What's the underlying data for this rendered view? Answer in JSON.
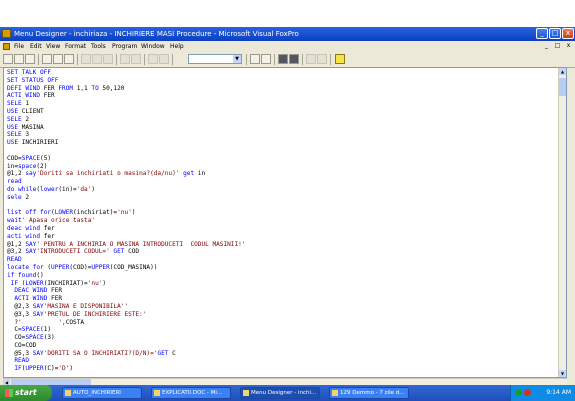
{
  "window": {
    "title": "Menu Designer - inchiriaza - INCHIRIERE MASI Procedure - Microsoft Visual FoxPro",
    "controls": {
      "minimize": "_",
      "maximize": "□",
      "close": "x"
    }
  },
  "menubar": {
    "items": [
      "File",
      "Edit",
      "View",
      "Format",
      "Tools",
      "Program",
      "Window",
      "Help"
    ],
    "mdi_controls": [
      "_",
      "□",
      "x"
    ]
  },
  "toolbar": {
    "icons": [
      "new-icon",
      "open-icon",
      "save-icon",
      "print-icon",
      "print-preview-icon",
      "spell-check-icon",
      "cut-icon",
      "copy-icon",
      "paste-icon",
      "undo-icon",
      "redo-icon",
      "run-icon",
      "modify-form-icon",
      "database-combo",
      "command-window-icon",
      "view-window-icon",
      "form-wizard-icon",
      "report-wizard-icon",
      "autoform-icon",
      "autoreport-icon",
      "help-icon"
    ],
    "combo_value": ""
  },
  "editor": {
    "lines": [
      [
        {
          "t": "kw",
          "v": "SET TALK OFF"
        }
      ],
      [
        {
          "t": "kw",
          "v": "SET STATUS OFF"
        }
      ],
      [
        {
          "t": "kw",
          "v": "DEFI WIND "
        },
        {
          "t": "txt",
          "v": "FER "
        },
        {
          "t": "kw",
          "v": "FROM "
        },
        {
          "t": "txt",
          "v": "1,1 "
        },
        {
          "t": "kw",
          "v": "TO "
        },
        {
          "t": "txt",
          "v": "50,120"
        }
      ],
      [
        {
          "t": "kw",
          "v": "ACTI WIND "
        },
        {
          "t": "txt",
          "v": "FER"
        }
      ],
      [
        {
          "t": "kw",
          "v": "SELE "
        },
        {
          "t": "txt",
          "v": "1"
        }
      ],
      [
        {
          "t": "kw",
          "v": "USE "
        },
        {
          "t": "txt",
          "v": "CLIENT"
        }
      ],
      [
        {
          "t": "kw",
          "v": "SELE "
        },
        {
          "t": "txt",
          "v": "2"
        }
      ],
      [
        {
          "t": "kw",
          "v": "USE "
        },
        {
          "t": "txt",
          "v": "MASINA"
        }
      ],
      [
        {
          "t": "kw",
          "v": "SELE "
        },
        {
          "t": "txt",
          "v": "3"
        }
      ],
      [
        {
          "t": "kw",
          "v": "USE "
        },
        {
          "t": "txt",
          "v": "INCHIRIERI"
        }
      ],
      [],
      [
        {
          "t": "txt",
          "v": "COD="
        },
        {
          "t": "kw",
          "v": "SPACE"
        },
        {
          "t": "txt",
          "v": "(5)"
        }
      ],
      [
        {
          "t": "txt",
          "v": "in="
        },
        {
          "t": "kw",
          "v": "space"
        },
        {
          "t": "txt",
          "v": "(2)"
        }
      ],
      [
        {
          "t": "txt",
          "v": "@1,2 "
        },
        {
          "t": "kw",
          "v": "say"
        },
        {
          "t": "str",
          "v": "'Doriti sa inchiriati o masina?(da/nu)' "
        },
        {
          "t": "kw",
          "v": "get "
        },
        {
          "t": "txt",
          "v": "in"
        }
      ],
      [
        {
          "t": "kw",
          "v": "read"
        }
      ],
      [
        {
          "t": "kw",
          "v": "do while"
        },
        {
          "t": "txt",
          "v": "("
        },
        {
          "t": "kw",
          "v": "lower"
        },
        {
          "t": "txt",
          "v": "(in)="
        },
        {
          "t": "str",
          "v": "'da'"
        },
        {
          "t": "txt",
          "v": ")"
        }
      ],
      [
        {
          "t": "kw",
          "v": "sele "
        },
        {
          "t": "txt",
          "v": "2"
        }
      ],
      [],
      [
        {
          "t": "kw",
          "v": "list off for"
        },
        {
          "t": "txt",
          "v": "("
        },
        {
          "t": "kw",
          "v": "LOWER"
        },
        {
          "t": "txt",
          "v": "(inchiriat)="
        },
        {
          "t": "str",
          "v": "'nu'"
        },
        {
          "t": "txt",
          "v": ")"
        }
      ],
      [
        {
          "t": "kw",
          "v": "wait"
        },
        {
          "t": "str",
          "v": "' Apasa orice tasta'"
        }
      ],
      [
        {
          "t": "kw",
          "v": "deac wind "
        },
        {
          "t": "txt",
          "v": "fer"
        }
      ],
      [
        {
          "t": "kw",
          "v": "acti wind "
        },
        {
          "t": "txt",
          "v": "fer"
        }
      ],
      [
        {
          "t": "txt",
          "v": "@1,2 "
        },
        {
          "t": "kw",
          "v": "SAY"
        },
        {
          "t": "str",
          "v": "' PENTRU A INCHIRIA O MASINA INTRODUCETI  CODUL MASINII!'"
        }
      ],
      [
        {
          "t": "txt",
          "v": "@3,2 "
        },
        {
          "t": "kw",
          "v": "SAY"
        },
        {
          "t": "str",
          "v": "'INTRODUCETI CODUL='"
        },
        {
          "t": "txt",
          "v": " "
        },
        {
          "t": "kw",
          "v": "GET "
        },
        {
          "t": "txt",
          "v": "COD"
        }
      ],
      [
        {
          "t": "kw",
          "v": "READ"
        }
      ],
      [
        {
          "t": "kw",
          "v": "locate for "
        },
        {
          "t": "txt",
          "v": "("
        },
        {
          "t": "kw",
          "v": "UPPER"
        },
        {
          "t": "txt",
          "v": "(COD)="
        },
        {
          "t": "kw",
          "v": "UPPER"
        },
        {
          "t": "txt",
          "v": "(COD_MASINA))"
        }
      ],
      [
        {
          "t": "kw",
          "v": "if found"
        },
        {
          "t": "txt",
          "v": "()"
        }
      ],
      [
        {
          "t": "txt",
          "v": " "
        },
        {
          "t": "kw",
          "v": "IF "
        },
        {
          "t": "txt",
          "v": "("
        },
        {
          "t": "kw",
          "v": "LOWER"
        },
        {
          "t": "txt",
          "v": "(INCHIRIAT)="
        },
        {
          "t": "str",
          "v": "'nu'"
        },
        {
          "t": "txt",
          "v": ")"
        }
      ],
      [
        {
          "t": "txt",
          "v": "  "
        },
        {
          "t": "kw",
          "v": "DEAC WIND "
        },
        {
          "t": "txt",
          "v": "FER"
        }
      ],
      [
        {
          "t": "txt",
          "v": "  "
        },
        {
          "t": "kw",
          "v": "ACTI WIND "
        },
        {
          "t": "txt",
          "v": "FER"
        }
      ],
      [
        {
          "t": "txt",
          "v": "  @2,3 "
        },
        {
          "t": "kw",
          "v": "SAY"
        },
        {
          "t": "str",
          "v": "'MASINA E DISPONIBILA'"
        },
        {
          "t": "txt",
          "v": "'"
        }
      ],
      [
        {
          "t": "txt",
          "v": "  @3,3 "
        },
        {
          "t": "kw",
          "v": "SAY"
        },
        {
          "t": "str",
          "v": "'PRETUL DE INCHIRIERE ESTE:'"
        }
      ],
      [
        {
          "t": "txt",
          "v": "  ?'          ',COSTA"
        }
      ],
      [
        {
          "t": "txt",
          "v": "  C="
        },
        {
          "t": "kw",
          "v": "SPACE"
        },
        {
          "t": "txt",
          "v": "(1)"
        }
      ],
      [
        {
          "t": "txt",
          "v": "  CO="
        },
        {
          "t": "kw",
          "v": "SPACE"
        },
        {
          "t": "txt",
          "v": "(3)"
        }
      ],
      [
        {
          "t": "txt",
          "v": "  CO=COD"
        }
      ],
      [
        {
          "t": "txt",
          "v": "  @5,3 "
        },
        {
          "t": "kw",
          "v": "SAY"
        },
        {
          "t": "str",
          "v": "'DORITI SA O INCHIRIATI?(D/N)='"
        },
        {
          "t": "kw",
          "v": "GET "
        },
        {
          "t": "txt",
          "v": "C"
        }
      ],
      [
        {
          "t": "txt",
          "v": "  "
        },
        {
          "t": "kw",
          "v": "READ"
        }
      ],
      [
        {
          "t": "txt",
          "v": "  "
        },
        {
          "t": "kw",
          "v": "IF"
        },
        {
          "t": "txt",
          "v": "("
        },
        {
          "t": "kw",
          "v": "UPPER"
        },
        {
          "t": "txt",
          "v": "(C)="
        },
        {
          "t": "str",
          "v": "'D'"
        },
        {
          "t": "txt",
          "v": ")"
        }
      ]
    ]
  },
  "taskbar": {
    "start_label": "start",
    "tasks": [
      {
        "label": "AUTO_INCHIRIERI",
        "active": false
      },
      {
        "label": "EXPLICATII.DOC - Mi...",
        "active": false
      },
      {
        "label": "Menu Designer - inchi...",
        "active": true
      },
      {
        "label": "129 Demmo - 7 zile d...",
        "active": false
      }
    ],
    "clock": "9:14 AM"
  },
  "colors": {
    "keyword": "#0000ff",
    "string": "#800000",
    "text": "#000000",
    "titlebar": "#0a3fc0",
    "taskbar": "#245edb"
  }
}
